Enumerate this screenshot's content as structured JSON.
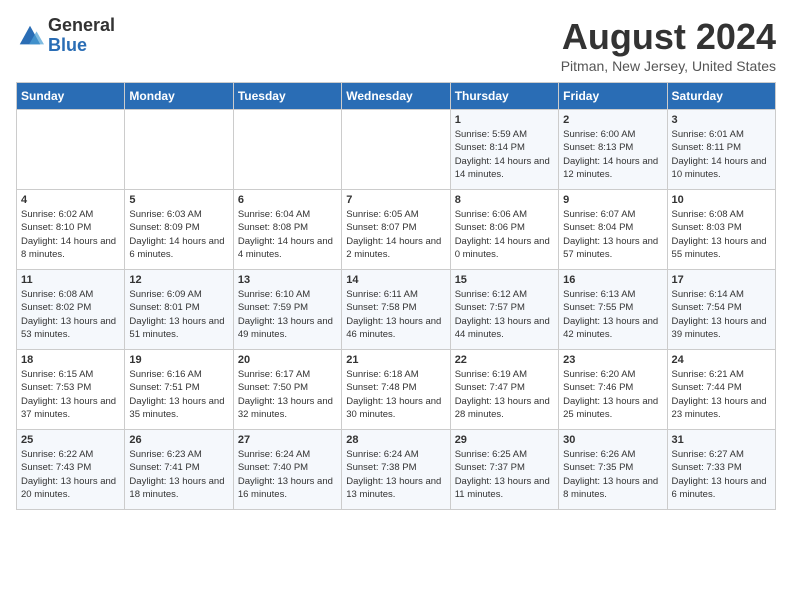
{
  "logo": {
    "general": "General",
    "blue": "Blue"
  },
  "title": "August 2024",
  "location": "Pitman, New Jersey, United States",
  "days_header": [
    "Sunday",
    "Monday",
    "Tuesday",
    "Wednesday",
    "Thursday",
    "Friday",
    "Saturday"
  ],
  "weeks": [
    [
      {
        "day": "",
        "sunrise": "",
        "sunset": "",
        "daylight": ""
      },
      {
        "day": "",
        "sunrise": "",
        "sunset": "",
        "daylight": ""
      },
      {
        "day": "",
        "sunrise": "",
        "sunset": "",
        "daylight": ""
      },
      {
        "day": "",
        "sunrise": "",
        "sunset": "",
        "daylight": ""
      },
      {
        "day": "1",
        "sunrise": "Sunrise: 5:59 AM",
        "sunset": "Sunset: 8:14 PM",
        "daylight": "Daylight: 14 hours and 14 minutes."
      },
      {
        "day": "2",
        "sunrise": "Sunrise: 6:00 AM",
        "sunset": "Sunset: 8:13 PM",
        "daylight": "Daylight: 14 hours and 12 minutes."
      },
      {
        "day": "3",
        "sunrise": "Sunrise: 6:01 AM",
        "sunset": "Sunset: 8:11 PM",
        "daylight": "Daylight: 14 hours and 10 minutes."
      }
    ],
    [
      {
        "day": "4",
        "sunrise": "Sunrise: 6:02 AM",
        "sunset": "Sunset: 8:10 PM",
        "daylight": "Daylight: 14 hours and 8 minutes."
      },
      {
        "day": "5",
        "sunrise": "Sunrise: 6:03 AM",
        "sunset": "Sunset: 8:09 PM",
        "daylight": "Daylight: 14 hours and 6 minutes."
      },
      {
        "day": "6",
        "sunrise": "Sunrise: 6:04 AM",
        "sunset": "Sunset: 8:08 PM",
        "daylight": "Daylight: 14 hours and 4 minutes."
      },
      {
        "day": "7",
        "sunrise": "Sunrise: 6:05 AM",
        "sunset": "Sunset: 8:07 PM",
        "daylight": "Daylight: 14 hours and 2 minutes."
      },
      {
        "day": "8",
        "sunrise": "Sunrise: 6:06 AM",
        "sunset": "Sunset: 8:06 PM",
        "daylight": "Daylight: 14 hours and 0 minutes."
      },
      {
        "day": "9",
        "sunrise": "Sunrise: 6:07 AM",
        "sunset": "Sunset: 8:04 PM",
        "daylight": "Daylight: 13 hours and 57 minutes."
      },
      {
        "day": "10",
        "sunrise": "Sunrise: 6:08 AM",
        "sunset": "Sunset: 8:03 PM",
        "daylight": "Daylight: 13 hours and 55 minutes."
      }
    ],
    [
      {
        "day": "11",
        "sunrise": "Sunrise: 6:08 AM",
        "sunset": "Sunset: 8:02 PM",
        "daylight": "Daylight: 13 hours and 53 minutes."
      },
      {
        "day": "12",
        "sunrise": "Sunrise: 6:09 AM",
        "sunset": "Sunset: 8:01 PM",
        "daylight": "Daylight: 13 hours and 51 minutes."
      },
      {
        "day": "13",
        "sunrise": "Sunrise: 6:10 AM",
        "sunset": "Sunset: 7:59 PM",
        "daylight": "Daylight: 13 hours and 49 minutes."
      },
      {
        "day": "14",
        "sunrise": "Sunrise: 6:11 AM",
        "sunset": "Sunset: 7:58 PM",
        "daylight": "Daylight: 13 hours and 46 minutes."
      },
      {
        "day": "15",
        "sunrise": "Sunrise: 6:12 AM",
        "sunset": "Sunset: 7:57 PM",
        "daylight": "Daylight: 13 hours and 44 minutes."
      },
      {
        "day": "16",
        "sunrise": "Sunrise: 6:13 AM",
        "sunset": "Sunset: 7:55 PM",
        "daylight": "Daylight: 13 hours and 42 minutes."
      },
      {
        "day": "17",
        "sunrise": "Sunrise: 6:14 AM",
        "sunset": "Sunset: 7:54 PM",
        "daylight": "Daylight: 13 hours and 39 minutes."
      }
    ],
    [
      {
        "day": "18",
        "sunrise": "Sunrise: 6:15 AM",
        "sunset": "Sunset: 7:53 PM",
        "daylight": "Daylight: 13 hours and 37 minutes."
      },
      {
        "day": "19",
        "sunrise": "Sunrise: 6:16 AM",
        "sunset": "Sunset: 7:51 PM",
        "daylight": "Daylight: 13 hours and 35 minutes."
      },
      {
        "day": "20",
        "sunrise": "Sunrise: 6:17 AM",
        "sunset": "Sunset: 7:50 PM",
        "daylight": "Daylight: 13 hours and 32 minutes."
      },
      {
        "day": "21",
        "sunrise": "Sunrise: 6:18 AM",
        "sunset": "Sunset: 7:48 PM",
        "daylight": "Daylight: 13 hours and 30 minutes."
      },
      {
        "day": "22",
        "sunrise": "Sunrise: 6:19 AM",
        "sunset": "Sunset: 7:47 PM",
        "daylight": "Daylight: 13 hours and 28 minutes."
      },
      {
        "day": "23",
        "sunrise": "Sunrise: 6:20 AM",
        "sunset": "Sunset: 7:46 PM",
        "daylight": "Daylight: 13 hours and 25 minutes."
      },
      {
        "day": "24",
        "sunrise": "Sunrise: 6:21 AM",
        "sunset": "Sunset: 7:44 PM",
        "daylight": "Daylight: 13 hours and 23 minutes."
      }
    ],
    [
      {
        "day": "25",
        "sunrise": "Sunrise: 6:22 AM",
        "sunset": "Sunset: 7:43 PM",
        "daylight": "Daylight: 13 hours and 20 minutes."
      },
      {
        "day": "26",
        "sunrise": "Sunrise: 6:23 AM",
        "sunset": "Sunset: 7:41 PM",
        "daylight": "Daylight: 13 hours and 18 minutes."
      },
      {
        "day": "27",
        "sunrise": "Sunrise: 6:24 AM",
        "sunset": "Sunset: 7:40 PM",
        "daylight": "Daylight: 13 hours and 16 minutes."
      },
      {
        "day": "28",
        "sunrise": "Sunrise: 6:24 AM",
        "sunset": "Sunset: 7:38 PM",
        "daylight": "Daylight: 13 hours and 13 minutes."
      },
      {
        "day": "29",
        "sunrise": "Sunrise: 6:25 AM",
        "sunset": "Sunset: 7:37 PM",
        "daylight": "Daylight: 13 hours and 11 minutes."
      },
      {
        "day": "30",
        "sunrise": "Sunrise: 6:26 AM",
        "sunset": "Sunset: 7:35 PM",
        "daylight": "Daylight: 13 hours and 8 minutes."
      },
      {
        "day": "31",
        "sunrise": "Sunrise: 6:27 AM",
        "sunset": "Sunset: 7:33 PM",
        "daylight": "Daylight: 13 hours and 6 minutes."
      }
    ]
  ]
}
